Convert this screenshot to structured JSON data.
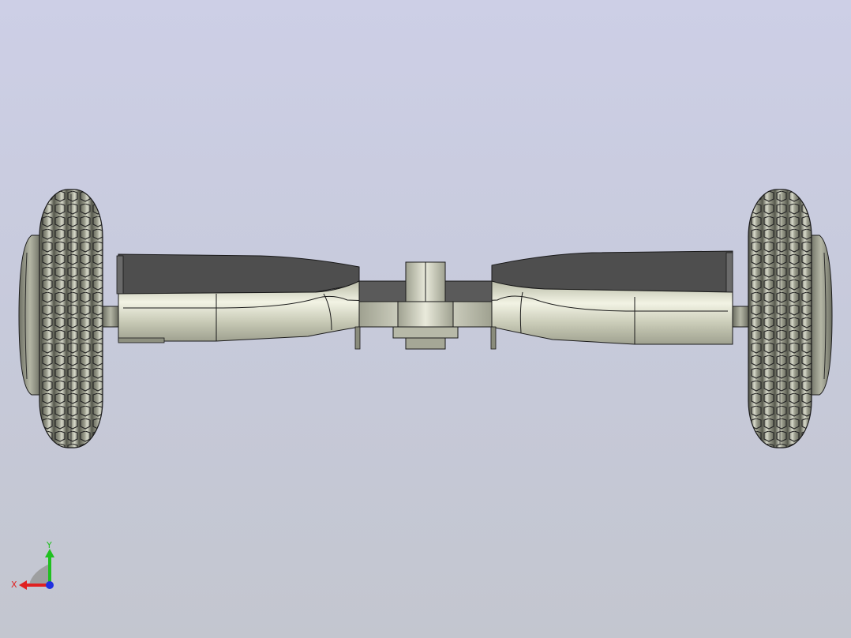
{
  "view": {
    "background_top": "#cdcfe6",
    "background_bottom": "#c3c6cf",
    "model_body_color": "#c9cbb9",
    "model_dark_face_color": "#505050",
    "edge_color": "#1a1a1a"
  },
  "triad": {
    "x_label": "X",
    "y_label": "Y",
    "x_color": "#e02020",
    "y_color": "#20c020",
    "z_color": "#2030e0"
  }
}
